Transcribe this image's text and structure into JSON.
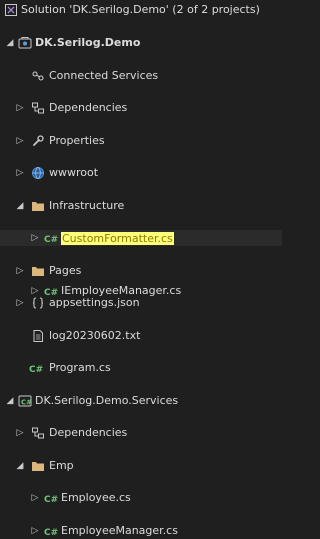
{
  "explorer": {
    "solution": {
      "label": "Solution 'DK.Serilog.Demo' (2 of 2 projects)"
    },
    "items": [
      {
        "label": "DK.Serilog.Demo",
        "icon": "project-icon",
        "chevron": "expanded",
        "bold": true
      },
      {
        "label": "Connected Services",
        "icon": "connected-services-icon",
        "chevron": "none"
      },
      {
        "label": "Dependencies",
        "icon": "dependencies-icon",
        "chevron": "collapsed"
      },
      {
        "label": "Properties",
        "icon": "wrench-icon",
        "chevron": "collapsed"
      },
      {
        "label": "wwwroot",
        "icon": "globe-icon",
        "chevron": "collapsed"
      },
      {
        "label": "Infrastructure",
        "icon": "folder-icon",
        "chevron": "expanded"
      },
      {
        "label": "CustomFormatter.cs",
        "icon": "csharp-file-icon",
        "chevron": "collapsed",
        "highlighted": true,
        "selected": true
      },
      {
        "label": "Pages",
        "icon": "folder-icon",
        "chevron": "collapsed"
      },
      {
        "label": "appsettings.json",
        "icon": "json-file-icon",
        "chevron": "collapsed"
      },
      {
        "label": "log20230602.txt",
        "icon": "text-file-icon",
        "chevron": "none"
      },
      {
        "label": "Program.cs",
        "icon": "csharp-file-icon",
        "chevron": "none"
      },
      {
        "label": "DK.Serilog.Demo.Services",
        "icon": "project-icon",
        "chevron": "expanded"
      },
      {
        "label": "Dependencies",
        "icon": "dependencies-icon",
        "chevron": "collapsed"
      },
      {
        "label": "Emp",
        "icon": "folder-icon",
        "chevron": "expanded"
      },
      {
        "label": "Employee.cs",
        "icon": "csharp-file-icon",
        "chevron": "collapsed"
      },
      {
        "label": "EmployeeManager.cs",
        "icon": "csharp-file-icon",
        "chevron": "collapsed"
      },
      {
        "label": "IEmployeeManager.cs",
        "icon": "csharp-file-icon",
        "chevron": "collapsed"
      }
    ],
    "colors": {
      "background": "#1f1f1f",
      "text": "#dcdcdc",
      "highlight": "#ffff7a",
      "folder": "#dcb67a",
      "csharp": "#6fc37a",
      "project": "#5c9fd6",
      "globe": "#4a90d9"
    }
  }
}
